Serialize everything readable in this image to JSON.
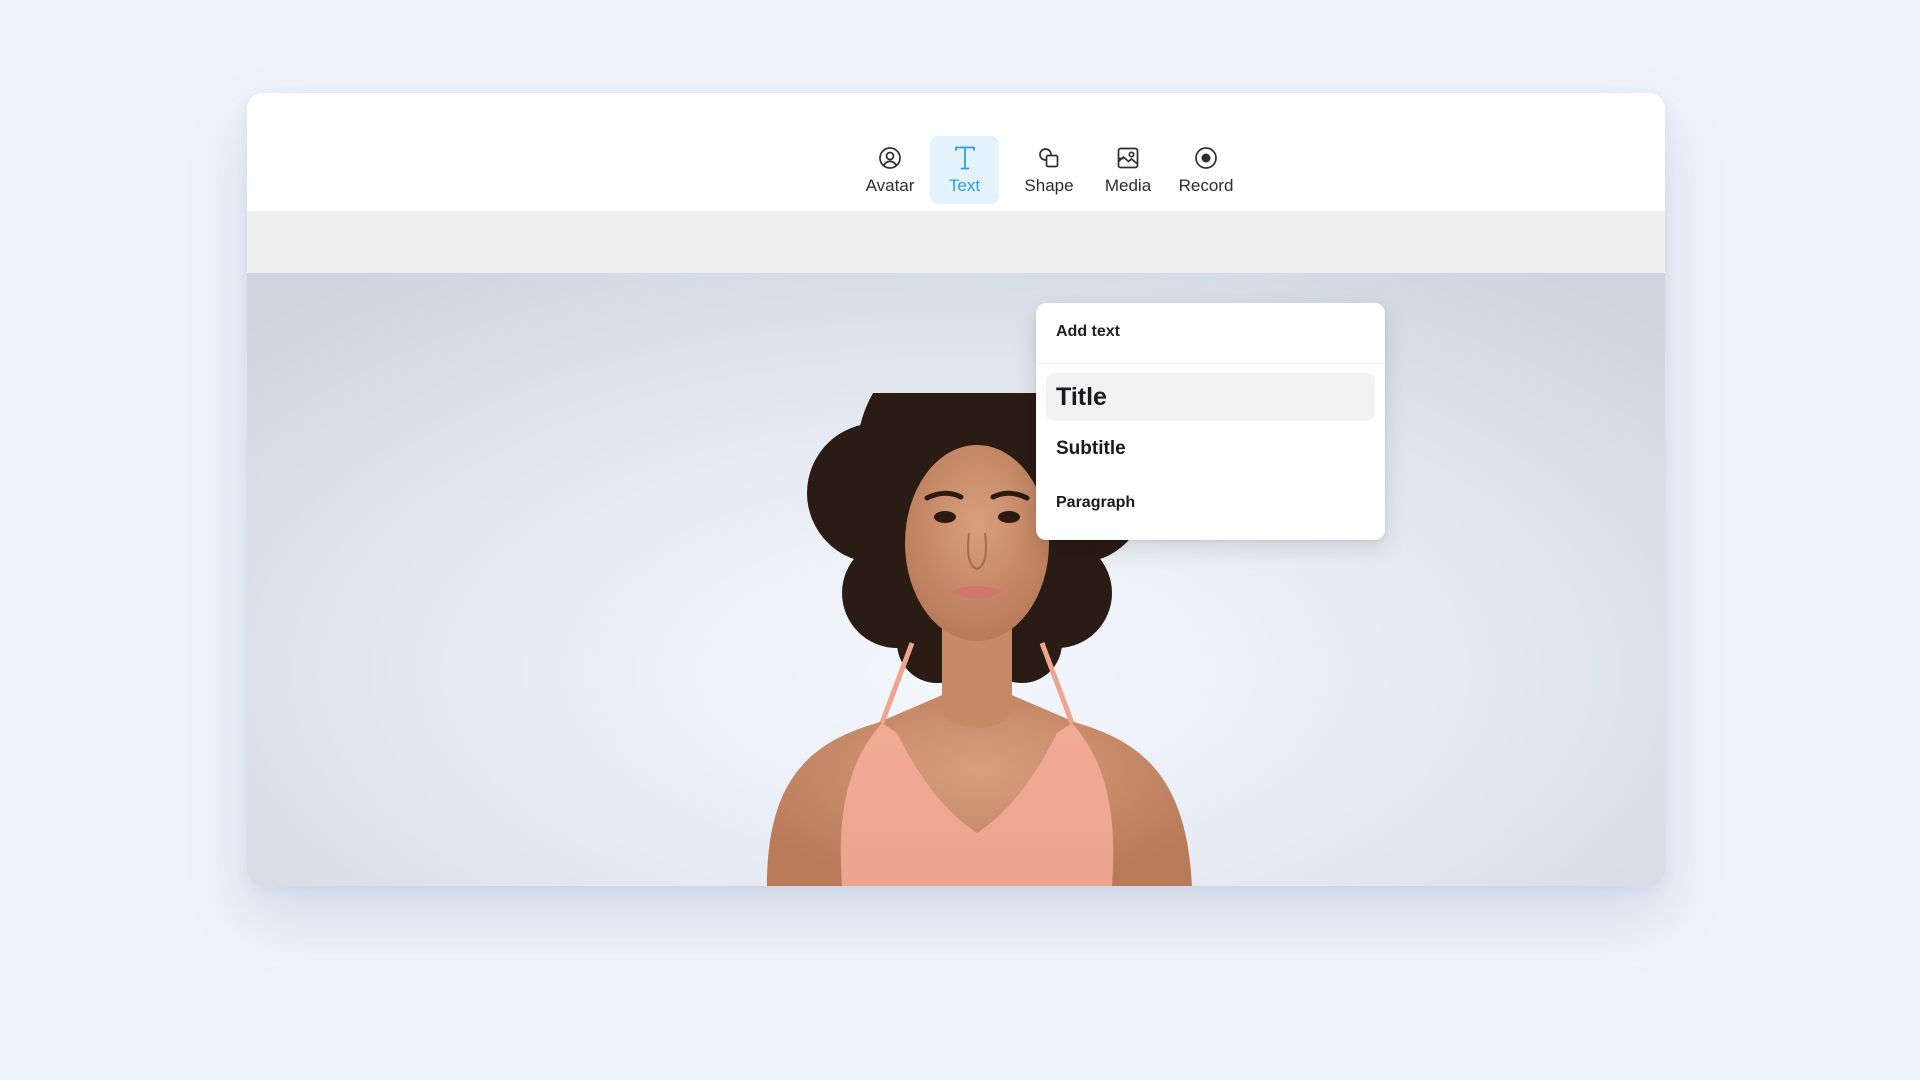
{
  "toolbar": {
    "items": [
      {
        "label": "Avatar",
        "icon": "avatar-icon",
        "active": false
      },
      {
        "label": "Text",
        "icon": "text-icon",
        "active": true
      },
      {
        "label": "Shape",
        "icon": "shape-icon",
        "active": false
      },
      {
        "label": "Media",
        "icon": "media-icon",
        "active": false
      },
      {
        "label": "Record",
        "icon": "record-icon",
        "active": false
      }
    ]
  },
  "text_menu": {
    "header": "Add text",
    "options": [
      {
        "label": "Title",
        "highlighted": true
      },
      {
        "label": "Subtitle",
        "highlighted": false
      },
      {
        "label": "Paragraph",
        "highlighted": false
      }
    ]
  },
  "colors": {
    "accent": "#2b9fe6",
    "active_tool_bg": "#e4f2fd",
    "page_bg": "#eef3fb",
    "subbar_bg": "#efefef",
    "highlight_bg": "#f2f2f2"
  }
}
